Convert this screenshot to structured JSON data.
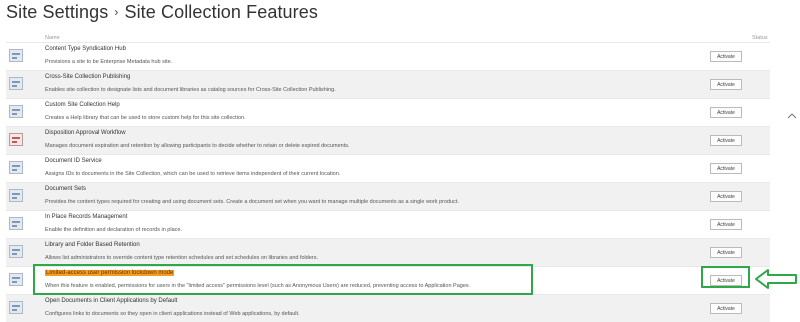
{
  "header": {
    "parent": "Site Settings",
    "separator": "›",
    "title": "Site Collection Features"
  },
  "columns": {
    "name": "Name",
    "status": "Status"
  },
  "features": [
    {
      "title": "Content Type Syndication Hub",
      "description": "Provisions a site to be Enterprise Metadata hub site.",
      "button": "Activate",
      "icon": "feature-icon"
    },
    {
      "title": "Cross-Site Collection Publishing",
      "description": "Enables site collection to designate lists and document libraries as catalog sources for Cross-Site Collection Publishing.",
      "button": "Activate",
      "icon": "feature-icon"
    },
    {
      "title": "Custom Site Collection Help",
      "description": "Creates a Help library that can be used to store custom help for this site collection.",
      "button": "Activate",
      "icon": "feature-icon"
    },
    {
      "title": "Disposition Approval Workflow",
      "description": "Manages document expiration and retention by allowing participants to decide whether to retain or delete expired documents.",
      "button": "Activate",
      "icon": "workflow-icon"
    },
    {
      "title": "Document ID Service",
      "description": "Assigns IDs to documents in the Site Collection, which can be used to retrieve items independent of their current location.",
      "button": "Activate",
      "icon": "feature-icon"
    },
    {
      "title": "Document Sets",
      "description": "Provides the content types required for creating and using document sets. Create a document set when you want to manage multiple documents as a single work product.",
      "button": "Activate",
      "icon": "feature-icon"
    },
    {
      "title": "In Place Records Management",
      "description": "Enable the definition and declaration of records in place.",
      "button": "Activate",
      "icon": "feature-icon"
    },
    {
      "title": "Library and Folder Based Retention",
      "description": "Allows list administrators to override content type retention schedules and set schedules on libraries and folders.",
      "button": "Activate",
      "icon": "feature-icon"
    },
    {
      "title": "Limited-access user permission lockdown mode",
      "description": "When this feature is enabled, permissions for users in the \"limited access\" permissions level (such as Anonymous Users) are reduced, preventing access to Application Pages.",
      "button": "Activate",
      "icon": "feature-icon"
    },
    {
      "title": "Open Documents in Client Applications by Default",
      "description": "Configures links to documents so they open in client applications instead of Web applications, by default.",
      "button": "Activate",
      "icon": "feature-icon"
    }
  ],
  "colors": {
    "highlight_box": "#2fa84a",
    "title_highlight": "#f0a01e",
    "alt_row": "#f1f1f1"
  }
}
